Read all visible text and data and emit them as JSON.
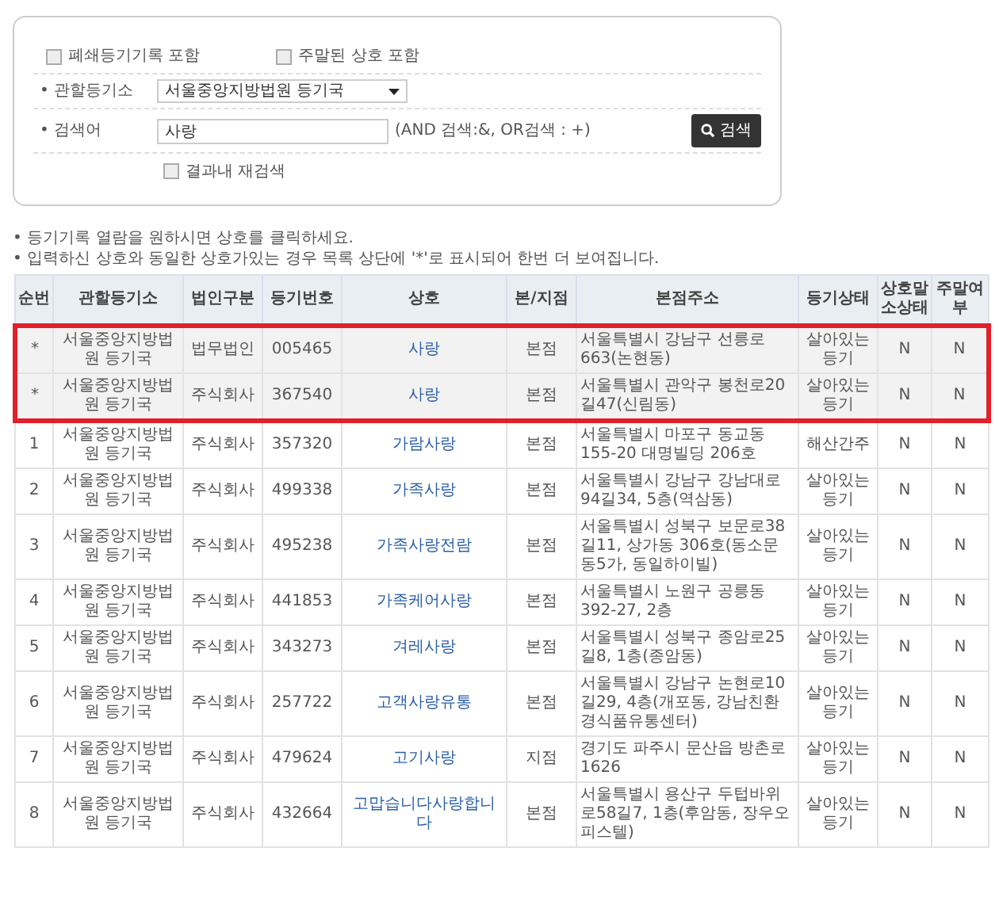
{
  "search_panel": {
    "options": [
      {
        "label": "폐쇄등기기록 포함",
        "checked": false
      },
      {
        "label": "주말된 상호 포함",
        "checked": false
      }
    ],
    "office": {
      "label": "• 관할등기소",
      "value": "서울중앙지방법원 등기국"
    },
    "keyword": {
      "label": "• 검색어",
      "value": "사랑",
      "hint": "(AND 검색:&, OR검색 : +)"
    },
    "search_button": "검색",
    "research": {
      "label": "결과내 재검색",
      "checked": false
    }
  },
  "notes": [
    "• 등기기록 열람을 원하시면 상호를 클릭하세요.",
    "• 입력하신 상호와 동일한 상호가있는 경우 목록 상단에 '*'로 표시되어 한번 더 보여집니다."
  ],
  "table": {
    "columns": [
      "순번",
      "관할등기소",
      "법인구분",
      "등기번호",
      "상호",
      "본/지점",
      "본점주소",
      "등기상태",
      "상호말소상태",
      "주말여부"
    ],
    "rows": [
      {
        "highlighted": true,
        "cells": [
          "*",
          "서울중앙지방법원 등기국",
          "법무법인",
          "005465",
          "사랑",
          "본점",
          "서울특별시 강남구 선릉로663(논현동)",
          "살아있는 등기",
          "N",
          "N"
        ]
      },
      {
        "highlighted": true,
        "cells": [
          "*",
          "서울중앙지방법원 등기국",
          "주식회사",
          "367540",
          "사랑",
          "본점",
          "서울특별시 관악구 봉천로20길47(신림동)",
          "살아있는 등기",
          "N",
          "N"
        ]
      },
      {
        "highlighted": false,
        "cells": [
          "1",
          "서울중앙지방법원 등기국",
          "주식회사",
          "357320",
          "가람사랑",
          "본점",
          "서울특별시 마포구 동교동155-20 대명빌딩 206호",
          "해산간주",
          "N",
          "N"
        ]
      },
      {
        "highlighted": false,
        "cells": [
          "2",
          "서울중앙지방법원 등기국",
          "주식회사",
          "499338",
          "가족사랑",
          "본점",
          "서울특별시 강남구 강남대로94길34, 5층(역삼동)",
          "살아있는 등기",
          "N",
          "N"
        ]
      },
      {
        "highlighted": false,
        "cells": [
          "3",
          "서울중앙지방법원 등기국",
          "주식회사",
          "495238",
          "가족사랑전람",
          "본점",
          "서울특별시 성북구 보문로38길11, 상가동 306호(동소문동5가, 동일하이빌)",
          "살아있는 등기",
          "N",
          "N"
        ]
      },
      {
        "highlighted": false,
        "cells": [
          "4",
          "서울중앙지방법원 등기국",
          "주식회사",
          "441853",
          "가족케어사랑",
          "본점",
          "서울특별시 노원구 공릉동392-27, 2층",
          "살아있는 등기",
          "N",
          "N"
        ]
      },
      {
        "highlighted": false,
        "cells": [
          "5",
          "서울중앙지방법원 등기국",
          "주식회사",
          "343273",
          "겨레사랑",
          "본점",
          "서울특별시 성북구 종암로25길8, 1층(종암동)",
          "살아있는 등기",
          "N",
          "N"
        ]
      },
      {
        "highlighted": false,
        "cells": [
          "6",
          "서울중앙지방법원 등기국",
          "주식회사",
          "257722",
          "고객사랑유통",
          "본점",
          "서울특별시 강남구 논현로10길29, 4층(개포동, 강남친환경식품유통센터)",
          "살아있는 등기",
          "N",
          "N"
        ]
      },
      {
        "highlighted": false,
        "cells": [
          "7",
          "서울중앙지방법원 등기국",
          "주식회사",
          "479624",
          "고기사랑",
          "지점",
          "경기도 파주시 문산읍 방촌로1626",
          "살아있는 등기",
          "N",
          "N"
        ]
      },
      {
        "highlighted": false,
        "cells": [
          "8",
          "서울중앙지방법원 등기국",
          "주식회사",
          "432664",
          "고맙습니다사랑합니다",
          "본점",
          "서울특별시 용산구 두텁바위로58길7, 1층(후암동, 장우오피스텔)",
          "살아있는 등기",
          "N",
          "N"
        ]
      }
    ]
  }
}
